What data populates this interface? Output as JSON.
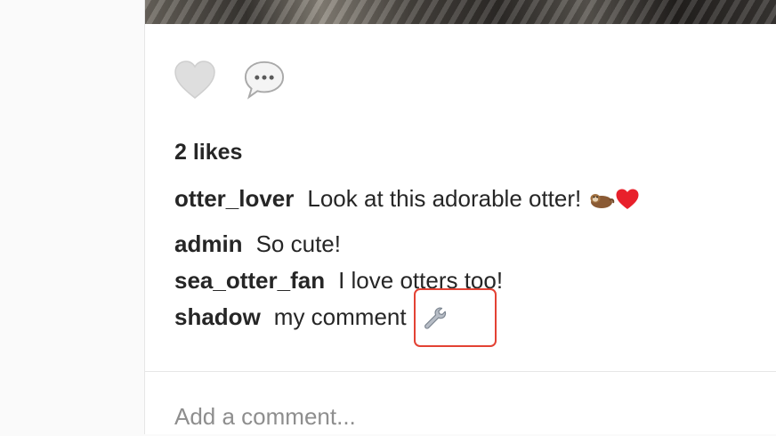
{
  "post": {
    "likes_text": "2 likes",
    "caption": {
      "user": "otter_lover",
      "text": "Look at this adorable otter!",
      "emojis": [
        "otter-icon",
        "red-heart-icon"
      ]
    },
    "comments": [
      {
        "user": "admin",
        "text": "So cute!"
      },
      {
        "user": "sea_otter_fan",
        "text": "I love otters too!"
      },
      {
        "user": "shadow",
        "text": "my comment",
        "icon": "wrench-icon"
      }
    ]
  },
  "actions": {
    "like_icon": "heart-outline-icon",
    "comment_icon": "speech-bubble-icon"
  },
  "comment_input": {
    "placeholder": "Add a comment..."
  },
  "colors": {
    "highlight": "#e34234",
    "heart": "#e8202b"
  }
}
